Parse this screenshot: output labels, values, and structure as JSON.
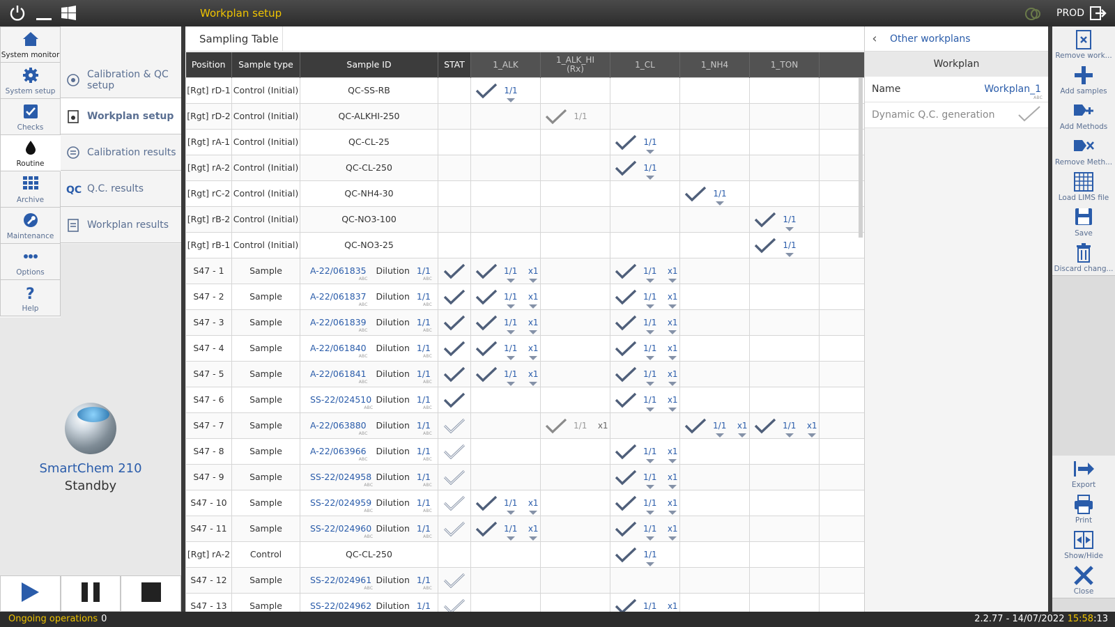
{
  "window": {
    "title": "Workplan setup",
    "env": "PROD"
  },
  "nav": [
    {
      "id": "system-monitor",
      "label": "System monitor",
      "icon": "home-icon"
    },
    {
      "id": "system-setup",
      "label": "System setup",
      "icon": "gear-icon"
    },
    {
      "id": "checks",
      "label": "Checks",
      "icon": "checkbox-icon"
    },
    {
      "id": "routine",
      "label": "Routine",
      "icon": "drop-icon"
    },
    {
      "id": "archive",
      "label": "Archive",
      "icon": "grid-icon"
    },
    {
      "id": "maintenance",
      "label": "Maintenance",
      "icon": "wrench-icon"
    },
    {
      "id": "options",
      "label": "Options",
      "icon": "dots-icon"
    },
    {
      "id": "help",
      "label": "Help",
      "icon": "question-icon"
    }
  ],
  "submenu": [
    {
      "label": "Calibration & QC setup",
      "icon": "calibration-icon"
    },
    {
      "label": "Workplan setup",
      "icon": "workplan-icon"
    },
    {
      "label": "Calibration results",
      "icon": "list-icon"
    },
    {
      "label": "Q.C. results",
      "icon": "qc-icon"
    },
    {
      "label": "Workplan results",
      "icon": "document-icon"
    }
  ],
  "instrument": {
    "name": "SmartChem 210",
    "state": "Standby"
  },
  "table": {
    "tab": "Sampling Table",
    "columns": [
      "Position",
      "Sample type",
      "Sample ID",
      "STAT",
      "1_ALK",
      "1_ALK_HI\n(Rx)",
      "1_CL",
      "1_NH4",
      "1_TON"
    ],
    "rows": [
      {
        "pos": "[Rgt] rD-1",
        "type": "Control (Initial)",
        "sid": "QC-SS-RB",
        "link": false,
        "stat": "",
        "m": {
          "ALK": "1/1"
        }
      },
      {
        "pos": "[Rgt] rD-2",
        "type": "Control (Initial)",
        "sid": "QC-ALKHI-250",
        "link": false,
        "stat": "",
        "m": {
          "ALKHI": "1/1d"
        }
      },
      {
        "pos": "[Rgt] rA-1",
        "type": "Control (Initial)",
        "sid": "QC-CL-25",
        "link": false,
        "stat": "",
        "m": {
          "CL": "1/1"
        }
      },
      {
        "pos": "[Rgt] rA-2",
        "type": "Control (Initial)",
        "sid": "QC-CL-250",
        "link": false,
        "stat": "",
        "m": {
          "CL": "1/1"
        }
      },
      {
        "pos": "[Rgt] rC-2",
        "type": "Control (Initial)",
        "sid": "QC-NH4-30",
        "link": false,
        "stat": "",
        "m": {
          "NH4": "1/1"
        }
      },
      {
        "pos": "[Rgt] rB-2",
        "type": "Control (Initial)",
        "sid": "QC-NO3-100",
        "link": false,
        "stat": "",
        "m": {
          "TON": "1/1"
        }
      },
      {
        "pos": "[Rgt] rB-1",
        "type": "Control (Initial)",
        "sid": "QC-NO3-25",
        "link": false,
        "stat": "",
        "m": {
          "TON": "1/1"
        }
      },
      {
        "pos": "S47 - 1",
        "type": "Sample",
        "sid": "A-22/061835",
        "link": true,
        "stat": "on",
        "m": {
          "ALK": "1/1x",
          "CL": "1/1x"
        }
      },
      {
        "pos": "S47 - 2",
        "type": "Sample",
        "sid": "A-22/061837",
        "link": true,
        "stat": "on",
        "m": {
          "ALK": "1/1x",
          "CL": "1/1x"
        }
      },
      {
        "pos": "S47 - 3",
        "type": "Sample",
        "sid": "A-22/061839",
        "link": true,
        "stat": "on",
        "m": {
          "ALK": "1/1x",
          "CL": "1/1x"
        }
      },
      {
        "pos": "S47 - 4",
        "type": "Sample",
        "sid": "A-22/061840",
        "link": true,
        "stat": "on",
        "m": {
          "ALK": "1/1x",
          "CL": "1/1x"
        }
      },
      {
        "pos": "S47 - 5",
        "type": "Sample",
        "sid": "A-22/061841",
        "link": true,
        "stat": "on",
        "m": {
          "ALK": "1/1x",
          "CL": "1/1x"
        }
      },
      {
        "pos": "S47 - 6",
        "type": "Sample",
        "sid": "SS-22/024510",
        "link": true,
        "stat": "on",
        "m": {
          "CL": "1/1x"
        }
      },
      {
        "pos": "S47 - 7",
        "type": "Sample",
        "sid": "A-22/063880",
        "link": true,
        "stat": "off",
        "m": {
          "ALKHI": "1/1xd",
          "NH4": "1/1x",
          "TON": "1/1x"
        }
      },
      {
        "pos": "S47 - 8",
        "type": "Sample",
        "sid": "A-22/063966",
        "link": true,
        "stat": "off",
        "m": {
          "CL": "1/1x"
        }
      },
      {
        "pos": "S47 - 9",
        "type": "Sample",
        "sid": "SS-22/024958",
        "link": true,
        "stat": "off",
        "m": {
          "CL": "1/1x"
        }
      },
      {
        "pos": "S47 - 10",
        "type": "Sample",
        "sid": "SS-22/024959",
        "link": true,
        "stat": "off",
        "m": {
          "ALK": "1/1x",
          "CL": "1/1x"
        }
      },
      {
        "pos": "S47 - 11",
        "type": "Sample",
        "sid": "SS-22/024960",
        "link": true,
        "stat": "off",
        "m": {
          "ALK": "1/1x",
          "CL": "1/1x"
        }
      },
      {
        "pos": "[Rgt] rA-2",
        "type": "Control",
        "sid": "QC-CL-250",
        "link": false,
        "stat": "",
        "m": {
          "CL": "1/1"
        }
      },
      {
        "pos": "S47 - 12",
        "type": "Sample",
        "sid": "SS-22/024961",
        "link": true,
        "stat": "off",
        "m": {}
      },
      {
        "pos": "S47 - 13",
        "type": "Sample",
        "sid": "SS-22/024962",
        "link": true,
        "stat": "off",
        "m": {
          "CL": "1/1x"
        }
      }
    ],
    "dilution_label": "Dilution",
    "dilution_value": "1/1",
    "mult_label": "x1",
    "abc": "ABC"
  },
  "right_panel": {
    "back_label": "Other workplans",
    "section": "Workplan",
    "name_label": "Name",
    "name_value": "Workplan_1",
    "dyn_label": "Dynamic Q.C. generation"
  },
  "toolbar": [
    {
      "label": "Remove work...",
      "icon": "remove-workplan-icon"
    },
    {
      "label": "Add samples",
      "icon": "plus-icon"
    },
    {
      "label": "Add Methods",
      "icon": "add-methods-icon"
    },
    {
      "label": "Remove Meth...",
      "icon": "remove-methods-icon"
    },
    {
      "label": "Load LIMS file",
      "icon": "lims-grid-icon"
    },
    {
      "label": "Save",
      "icon": "save-icon"
    },
    {
      "label": "Discard chang...",
      "icon": "trash-icon"
    }
  ],
  "toolbar_bottom": [
    {
      "label": "Export",
      "icon": "export-icon"
    },
    {
      "label": "Print",
      "icon": "print-icon"
    },
    {
      "label": "Show/Hide",
      "icon": "show-hide-icon"
    },
    {
      "label": "Close",
      "icon": "close-icon"
    }
  ],
  "status": {
    "ops_label": "Ongoing operations",
    "ops_count": "0",
    "version": "2.2.77 - 14/07/2022",
    "time": "15:58",
    "seconds": ":13"
  },
  "colors": {
    "accent": "#2a5caa",
    "title": "#f0c400",
    "bar": "#2c2c2c"
  }
}
